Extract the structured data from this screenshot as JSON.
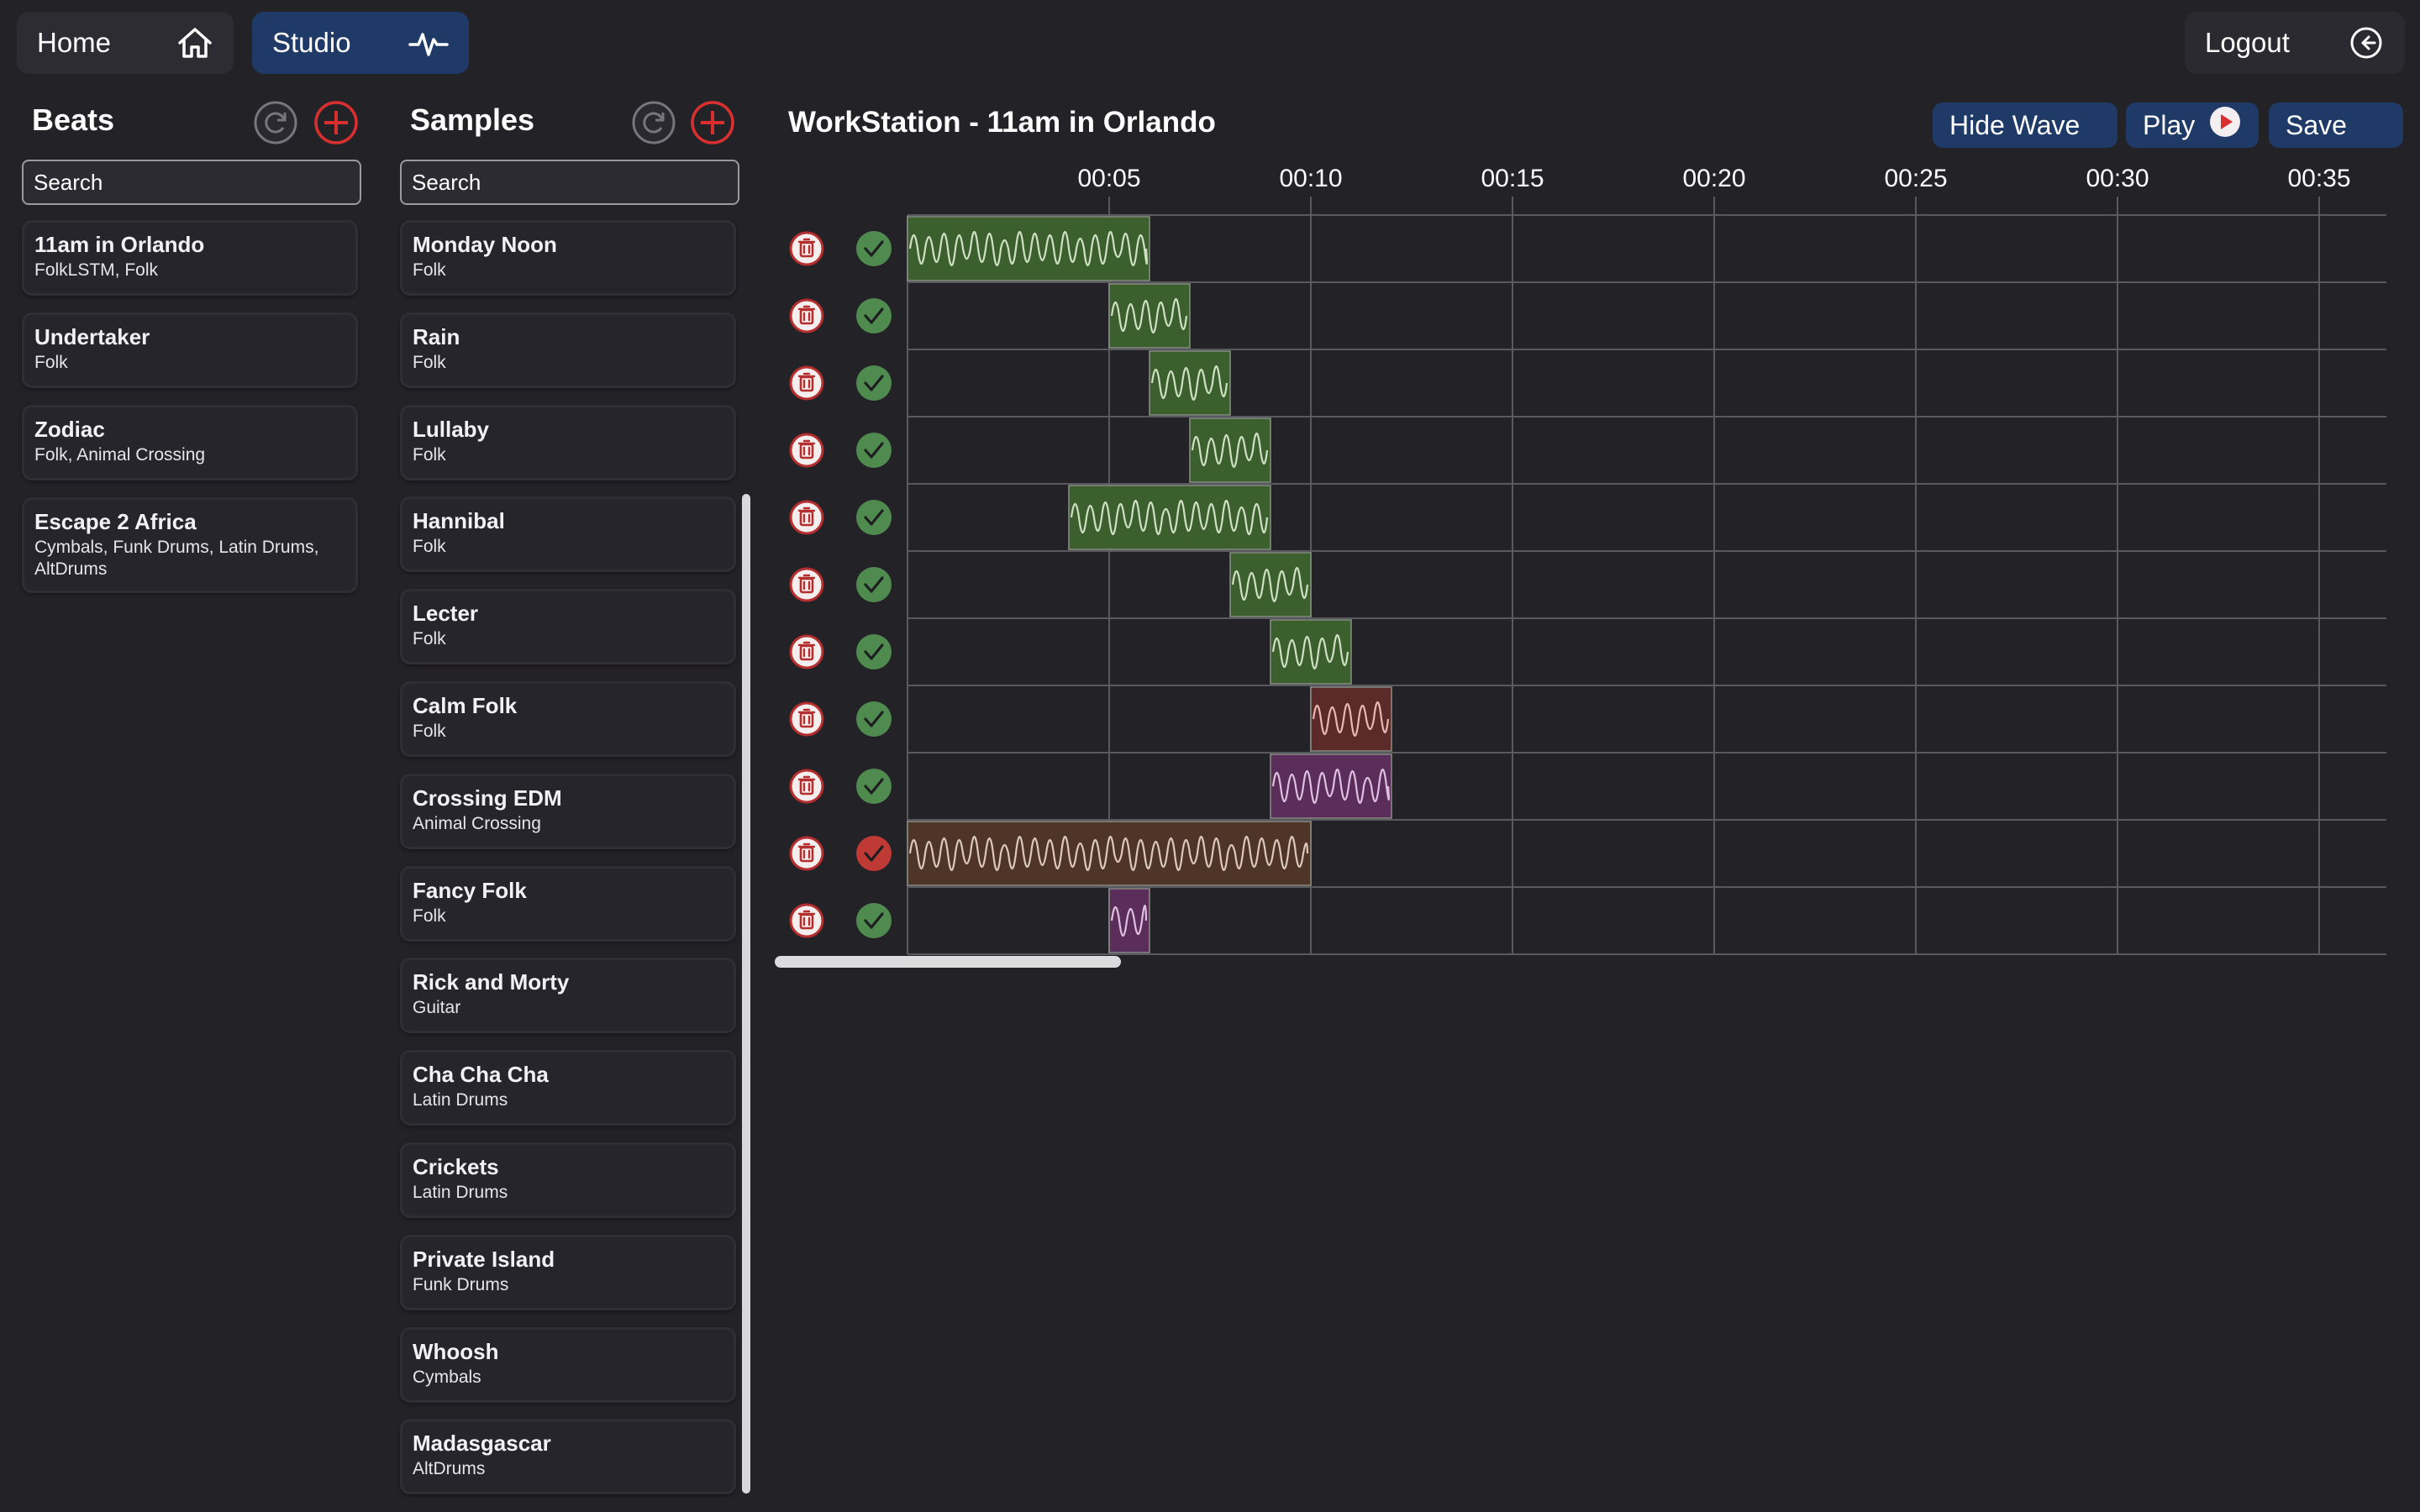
{
  "nav": {
    "home_label": "Home",
    "studio_label": "Studio",
    "logout_label": "Logout"
  },
  "beats": {
    "title": "Beats",
    "search_placeholder": "Search",
    "items": [
      {
        "name": "11am in Orlando",
        "tags": "FolkLSTM, Folk"
      },
      {
        "name": "Undertaker",
        "tags": "Folk"
      },
      {
        "name": "Zodiac",
        "tags": "Folk, Animal Crossing"
      },
      {
        "name": "Escape 2 Africa",
        "tags": "Cymbals, Funk Drums, Latin Drums, AltDrums"
      }
    ]
  },
  "samples": {
    "title": "Samples",
    "search_placeholder": "Search",
    "items": [
      {
        "name": "Monday Noon",
        "tags": "Folk"
      },
      {
        "name": "Rain",
        "tags": "Folk"
      },
      {
        "name": "Lullaby",
        "tags": "Folk"
      },
      {
        "name": "Hannibal",
        "tags": "Folk"
      },
      {
        "name": "Lecter",
        "tags": "Folk"
      },
      {
        "name": "Calm Folk",
        "tags": "Folk"
      },
      {
        "name": "Crossing EDM",
        "tags": "Animal Crossing"
      },
      {
        "name": "Fancy Folk",
        "tags": "Folk"
      },
      {
        "name": "Rick and Morty",
        "tags": "Guitar"
      },
      {
        "name": "Cha Cha Cha",
        "tags": "Latin Drums"
      },
      {
        "name": "Crickets",
        "tags": "Latin Drums"
      },
      {
        "name": "Private Island",
        "tags": "Funk Drums"
      },
      {
        "name": "Whoosh",
        "tags": "Cymbals"
      },
      {
        "name": "Madasgascar",
        "tags": "AltDrums"
      }
    ]
  },
  "workstation": {
    "title": "WorkStation - 11am in Orlando",
    "hide_wave_label": "Hide Wave",
    "play_label": "Play",
    "save_label": "Save",
    "time_labels": [
      "00:05",
      "00:10",
      "00:15",
      "00:20",
      "00:25",
      "00:30",
      "00:35"
    ],
    "tracks": [
      {
        "start": 0,
        "end": 6,
        "color": "#3c5f2e",
        "enabled": true
      },
      {
        "start": 5,
        "end": 7,
        "color": "#3c5f2e",
        "enabled": true
      },
      {
        "start": 6,
        "end": 8,
        "color": "#3c5f2e",
        "enabled": true
      },
      {
        "start": 7,
        "end": 9,
        "color": "#3c5f2e",
        "enabled": true
      },
      {
        "start": 4,
        "end": 9,
        "color": "#3c5f2e",
        "enabled": true
      },
      {
        "start": 8,
        "end": 10,
        "color": "#3c5f2e",
        "enabled": true
      },
      {
        "start": 9,
        "end": 11,
        "color": "#3c5f2e",
        "enabled": true
      },
      {
        "start": 10,
        "end": 12,
        "color": "#5c2a28",
        "enabled": true
      },
      {
        "start": 9,
        "end": 12,
        "color": "#5a2d5a",
        "enabled": true
      },
      {
        "start": 0,
        "end": 10,
        "color": "#4e3528",
        "enabled": false
      },
      {
        "start": 5,
        "end": 6,
        "color": "#5a2d5a",
        "enabled": true
      }
    ]
  },
  "colors": {
    "accent_blue": "#1f3a66",
    "add_red": "#d9302f",
    "check_green": "#4f8a4f",
    "check_red": "#c03a35",
    "delete_red": "#b52f2f"
  }
}
